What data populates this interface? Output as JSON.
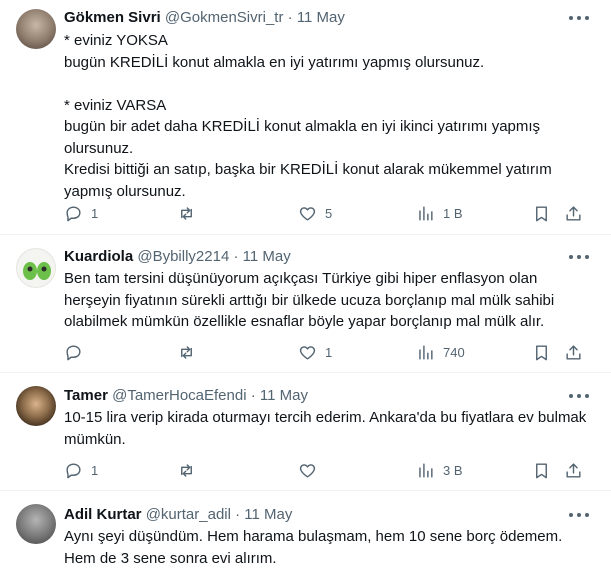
{
  "tweets": [
    {
      "name": "Gökmen Sivri",
      "handle": "@GokmenSivri_tr",
      "separator": "·",
      "date": "11 May",
      "text": "* eviniz YOKSA\nbugün KREDİLİ konut almakla en iyi yatırımı yapmış olursunuz.\n\n* eviniz VARSA\nbugün bir adet daha KREDİLİ konut almakla en iyi ikinci yatırımı yapmış olursunuz.\nKredisi bittiği an satıp, başka bir KREDİLİ konut alarak mükemmel yatırım yapmış olursunuz.",
      "replies": "1",
      "retweets": "",
      "likes": "5",
      "views": "1 B"
    },
    {
      "name": "Kuardiola",
      "handle": "@Bybilly2214",
      "separator": "·",
      "date": "11 May",
      "text": "Ben tam tersini düşünüyorum açıkçası Türkiye gibi hiper enflasyon olan herşeyin fiyatının sürekli arttığı  bir ülkede ucuza borçlanıp mal mülk sahibi olabilmek mümkün özellikle esnaflar böyle yapar borçlanıp mal mülk alır.",
      "replies": "",
      "retweets": "",
      "likes": "1",
      "views": "740"
    },
    {
      "name": "Tamer",
      "handle": "@TamerHocaEfendi",
      "separator": "·",
      "date": "11 May",
      "text": "10-15 lira verip kirada oturmayı tercih ederim. Ankara'da bu fiyatlara ev bulmak mümkün.",
      "replies": "1",
      "retweets": "",
      "likes": "",
      "views": "3 B"
    },
    {
      "name": "Adil Kurtar",
      "handle": "@kurtar_adil",
      "separator": "·",
      "date": "11 May",
      "text": "Aynı şeyi düşündüm. Hem harama bulaşmam, hem 10 sene borç ödemem. Hem de 3 sene sonra evi alırım.",
      "replies": "",
      "retweets": "",
      "likes": "",
      "views": ""
    }
  ]
}
